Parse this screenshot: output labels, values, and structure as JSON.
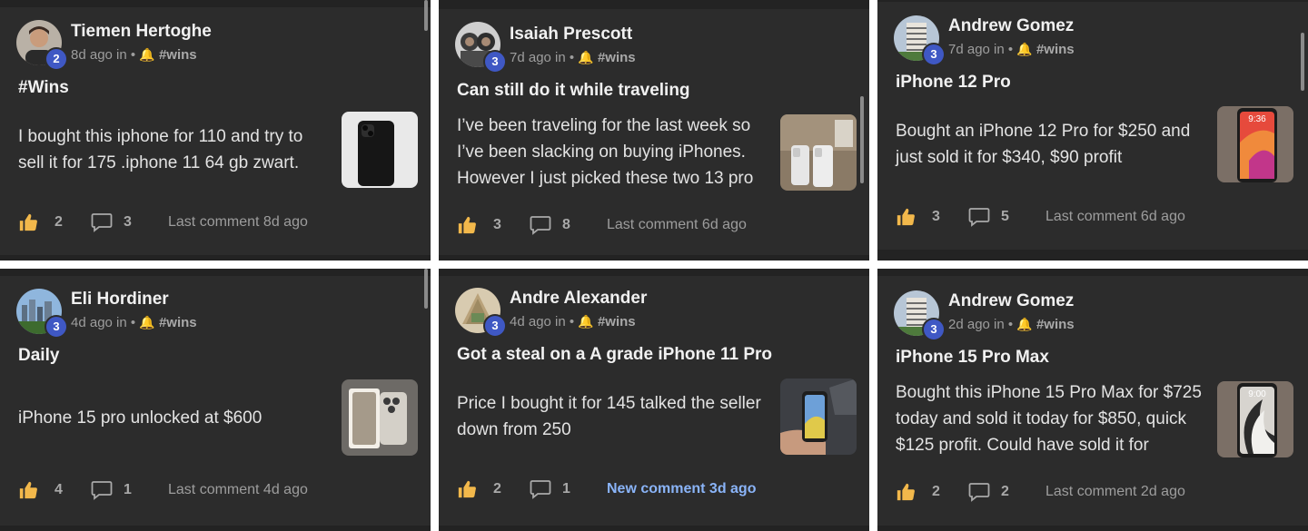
{
  "posts": [
    {
      "author": "Tiemen Hertoghe",
      "level": "2",
      "time": "8d ago in",
      "sep": "•",
      "channel": "#wins",
      "title": "#Wins",
      "body": "I bought this iphone for 110 and try to sell it for 175 .iphone 11 64 gb zwart.",
      "likes": "2",
      "comments": "3",
      "comment_status": "Last comment 8d ago"
    },
    {
      "author": "Isaiah Prescott",
      "level": "3",
      "time": "7d ago in",
      "sep": "•",
      "channel": "#wins",
      "title": "Can still do it while traveling",
      "body": "I’ve been traveling for the last week so I’ve been slacking on buying iPhones. However I just picked these two 13 pro",
      "likes": "3",
      "comments": "8",
      "comment_status": "Last comment 6d ago"
    },
    {
      "author": "Andrew Gomez",
      "level": "3",
      "time": "7d ago in",
      "sep": "•",
      "channel": "#wins",
      "title": "iPhone 12 Pro",
      "body": "Bought an iPhone 12 Pro for $250 and just sold it for $340, $90 profit",
      "likes": "3",
      "comments": "5",
      "comment_status": "Last comment 6d ago",
      "thumb_time": "9:36"
    },
    {
      "author": "Eli Hordiner",
      "level": "3",
      "time": "4d ago in",
      "sep": "•",
      "channel": "#wins",
      "title": "Daily",
      "body": "iPhone 15 pro unlocked at $600",
      "likes": "4",
      "comments": "1",
      "comment_status": "Last comment 4d ago"
    },
    {
      "author": "Andre Alexander",
      "level": "3",
      "time": "4d ago in",
      "sep": "•",
      "channel": "#wins",
      "title": "Got a steal on a A grade iPhone 11 Pro",
      "body": "Price I bought it for 145 talked the seller down from 250",
      "likes": "2",
      "comments": "1",
      "comment_status": "New comment 3d ago"
    },
    {
      "author": "Andrew Gomez",
      "level": "3",
      "time": "2d ago in",
      "sep": "•",
      "channel": "#wins",
      "title": "iPhone 15 Pro Max",
      "body": "Bought this iPhone 15 Pro Max for $725 today and sold it today for $850, quick $125 profit. Could have sold it for",
      "likes": "2",
      "comments": "2",
      "comment_status": "Last comment 2d ago",
      "thumb_time": "9:00"
    }
  ],
  "icons": {
    "like": "thumbs-up-icon",
    "comment": "speech-bubble-icon",
    "channel": "bell-icon"
  },
  "colors": {
    "card_bg": "#2c2c2c",
    "level_badge": "#3f58c4",
    "new_comment": "#8ab4f8",
    "like_icon": "#f2b84b"
  }
}
